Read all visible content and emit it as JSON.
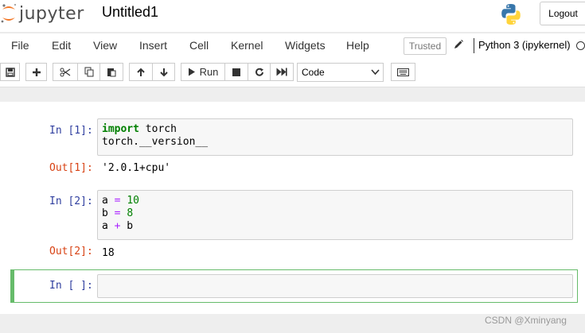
{
  "app": {
    "logo_text": "jupyter",
    "notebook_title": "Untitled1",
    "logout_label": "Logout"
  },
  "menu": {
    "items": [
      {
        "label": "File"
      },
      {
        "label": "Edit"
      },
      {
        "label": "View"
      },
      {
        "label": "Insert"
      },
      {
        "label": "Cell"
      },
      {
        "label": "Kernel"
      },
      {
        "label": "Widgets"
      },
      {
        "label": "Help"
      }
    ],
    "trusted_label": "Trusted",
    "kernel_name": "Python 3 (ipykernel)"
  },
  "toolbar": {
    "run_label": "Run",
    "cell_type": "Code",
    "icons": [
      "save-icon",
      "plus-icon",
      "cut-icon",
      "copy-icon",
      "paste-icon",
      "arrow-up-icon",
      "arrow-down-icon",
      "play-icon",
      "stop-icon",
      "restart-icon",
      "fast-forward-icon",
      "keyboard-icon"
    ]
  },
  "cells": [
    {
      "prompt": "In [1]:",
      "code": [
        "import torch",
        "torch.__version__"
      ],
      "out_prompt": "Out[1]:",
      "output": "'2.0.1+cpu'"
    },
    {
      "prompt": "In [2]:",
      "code": [
        "a = 10",
        "b = 8",
        "a + b"
      ],
      "out_prompt": "Out[2]:",
      "output": "18"
    },
    {
      "prompt": "In [ ]:",
      "code": []
    }
  ],
  "watermark": "CSDN @Xminyang",
  "colors": {
    "in_prompt": "#303f9f",
    "out_prompt": "#d84315",
    "selected_border": "#66bb6a"
  }
}
